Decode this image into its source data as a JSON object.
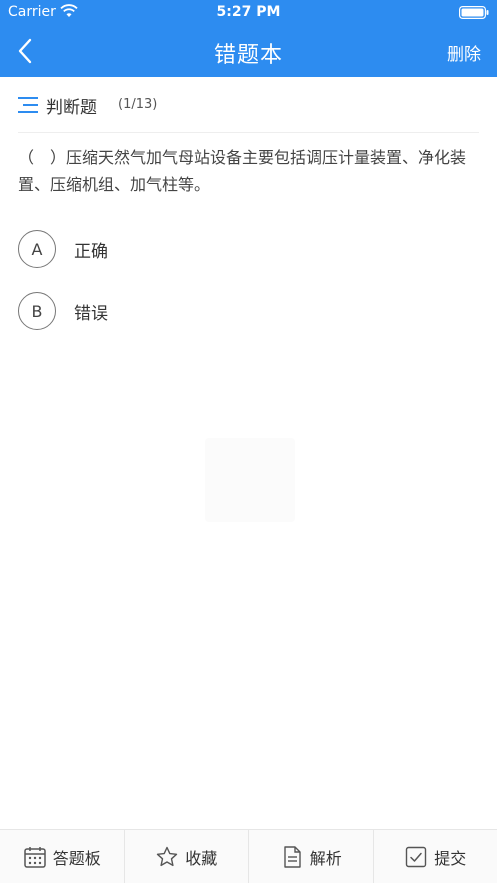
{
  "status_bar": {
    "carrier": "Carrier",
    "time": "5:27 PM"
  },
  "nav": {
    "title": "错题本",
    "delete_label": "删除"
  },
  "question": {
    "type": "判断题",
    "progress": "(1/13)",
    "text": "（　）压缩天然气加气母站设备主要包括调压计量装置、净化装置、压缩机组、加气柱等。",
    "options": [
      {
        "letter": "A",
        "label": "正确"
      },
      {
        "letter": "B",
        "label": "错误"
      }
    ]
  },
  "toolbar": {
    "answer_sheet": "答题板",
    "favorite": "收藏",
    "analysis": "解析",
    "submit": "提交"
  },
  "colors": {
    "header_bg": "#2d8cf0",
    "accent": "#2d8cf0"
  }
}
